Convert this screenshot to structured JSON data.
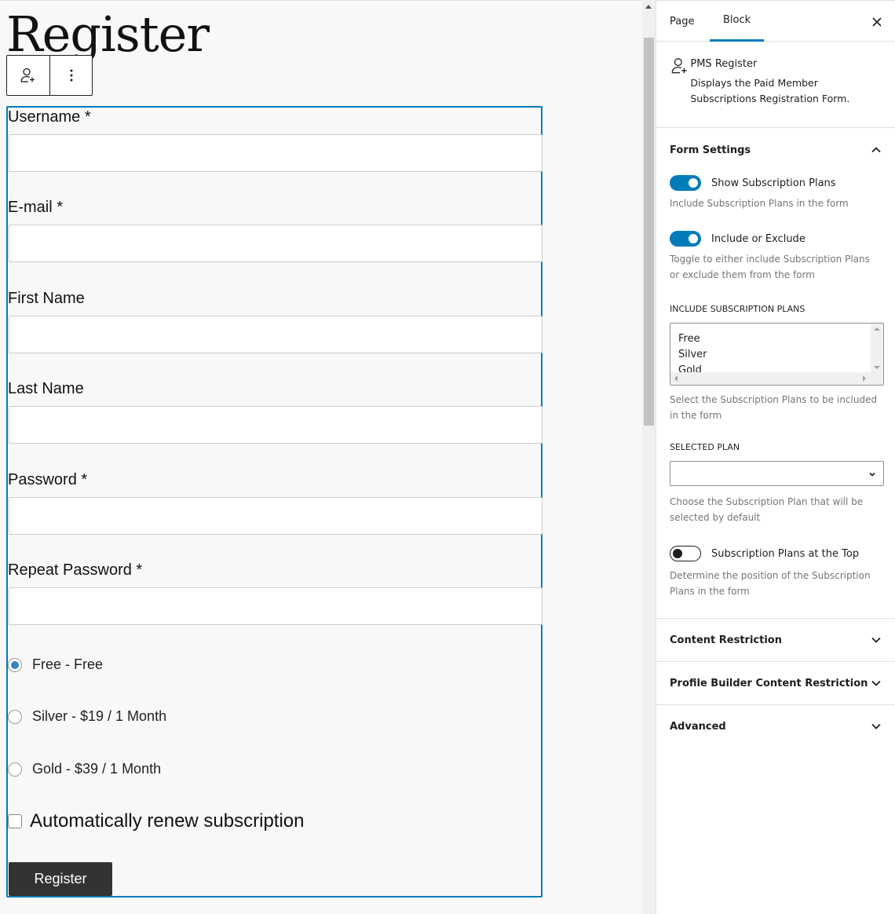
{
  "editor": {
    "page_title": "Register",
    "toolbar": {
      "block_icon": "user-plus-icon",
      "options_icon": "more-vertical-icon"
    },
    "form": {
      "fields": [
        {
          "label": "Username *",
          "value": ""
        },
        {
          "label": "E-mail *",
          "value": ""
        },
        {
          "label": "First Name",
          "value": ""
        },
        {
          "label": "Last Name",
          "value": ""
        },
        {
          "label": "Password *",
          "value": ""
        },
        {
          "label": "Repeat Password *",
          "value": ""
        }
      ],
      "plans": [
        {
          "label": "Free - Free",
          "checked": true
        },
        {
          "label": "Silver - $19 / 1 Month",
          "checked": false
        },
        {
          "label": "Gold - $39 / 1 Month",
          "checked": false
        }
      ],
      "auto_renew_label": "Automatically renew subscription",
      "auto_renew_checked": false,
      "submit_label": "Register"
    }
  },
  "sidebar": {
    "tabs": [
      {
        "label": "Page",
        "active": false
      },
      {
        "label": "Block",
        "active": true
      }
    ],
    "close_icon": "close-icon",
    "block": {
      "icon": "user-plus-icon",
      "title": "PMS Register",
      "description": "Displays the Paid Member Subscriptions Registration Form."
    },
    "form_settings": {
      "title": "Form Settings",
      "expanded": true,
      "show_plans": {
        "label": "Show Subscription Plans",
        "on": true,
        "help": "Include Subscription Plans in the form"
      },
      "include_exclude": {
        "label": "Include or Exclude",
        "on": true,
        "help": "Toggle to either include Subscription Plans or exclude them from the form"
      },
      "include_plans": {
        "label": "INCLUDE SUBSCRIPTION PLANS",
        "options": [
          "Free",
          "Silver",
          "Gold"
        ],
        "help": "Select the Subscription Plans to be included in the form"
      },
      "selected_plan": {
        "label": "SELECTED PLAN",
        "value": "",
        "help": "Choose the Subscription Plan that will be selected by default"
      },
      "plans_top": {
        "label": "Subscription Plans at the Top",
        "on": false,
        "help": "Determine the position of the Subscription Plans in the form"
      }
    },
    "panels": [
      {
        "title": "Content Restriction",
        "expanded": false
      },
      {
        "title": "Profile Builder Content Restriction",
        "expanded": false
      },
      {
        "title": "Advanced",
        "expanded": false
      }
    ],
    "colors": {
      "accent": "#007cba",
      "text": "#1e1e1e",
      "help": "#757575"
    }
  }
}
